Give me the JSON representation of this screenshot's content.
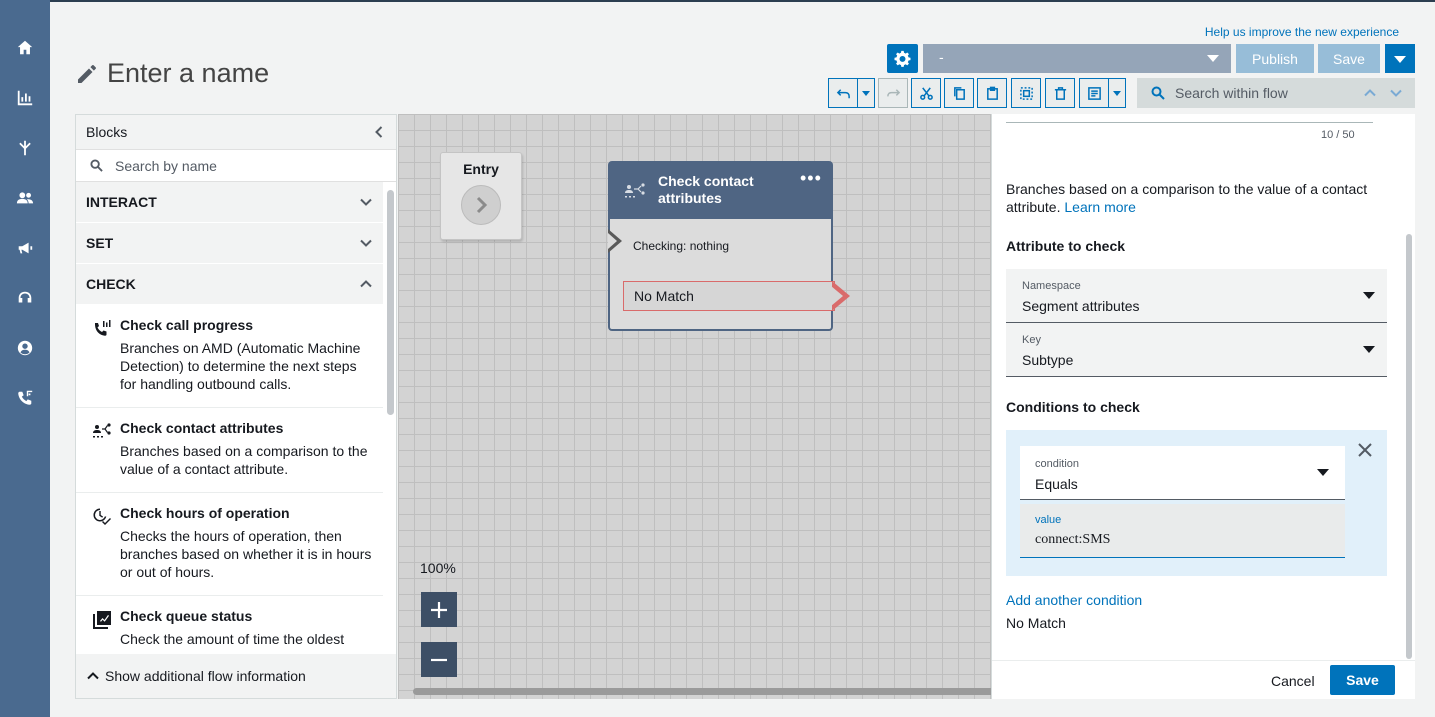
{
  "nav_rail": {
    "items": [
      {
        "icon": "home-icon"
      },
      {
        "icon": "analytics-icon"
      },
      {
        "icon": "routing-icon"
      },
      {
        "icon": "users-icon"
      },
      {
        "icon": "campaigns-icon"
      },
      {
        "icon": "headset-icon"
      },
      {
        "icon": "profile-icon"
      },
      {
        "icon": "phone-channels-icon"
      }
    ]
  },
  "header": {
    "help_link": "Help us improve the new experience",
    "page_title": "Enter a name",
    "version_select": "-",
    "publish_label": "Publish",
    "save_label": "Save"
  },
  "toolbar": {
    "search_placeholder": "Search within flow"
  },
  "blocks_panel": {
    "title": "Blocks",
    "search_placeholder": "Search by name",
    "categories": {
      "interact": "INTERACT",
      "set": "SET",
      "check": "CHECK"
    },
    "blocks": [
      {
        "name": "Check call progress",
        "description": "Branches on AMD (Automatic Machine Detection) to determine the next steps for handling outbound calls."
      },
      {
        "name": "Check contact attributes",
        "description": "Branches based on a comparison to the value of a contact attribute."
      },
      {
        "name": "Check hours of operation",
        "description": "Checks the hours of operation, then branches based on whether it is in hours or out of hours."
      },
      {
        "name": "Check queue status",
        "description": "Check the amount of time the oldest"
      }
    ],
    "footer_label": "Show additional flow information"
  },
  "canvas": {
    "entry_label": "Entry",
    "node": {
      "title": "Check contact attributes",
      "checking": "Checking: nothing",
      "branch": "No Match"
    },
    "zoom_level": "100%"
  },
  "properties": {
    "counter": "10 / 50",
    "description": "Branches based on a comparison to the value of a contact attribute.",
    "learn_more": "Learn more",
    "attribute_heading": "Attribute to check",
    "namespace": {
      "label": "Namespace",
      "value": "Segment attributes"
    },
    "key": {
      "label": "Key",
      "value": "Subtype"
    },
    "conditions_heading": "Conditions to check",
    "condition": {
      "label": "condition",
      "value": "Equals"
    },
    "value": {
      "label": "value",
      "value": "connect:SMS"
    },
    "add_condition": "Add another condition",
    "no_match": "No Match",
    "cancel_label": "Cancel",
    "save_label": "Save"
  },
  "colors": {
    "rail": "#4a6a8f",
    "accent": "#0073bb",
    "node_header": "#4f6583",
    "condition_bg": "#e1f0fa"
  }
}
